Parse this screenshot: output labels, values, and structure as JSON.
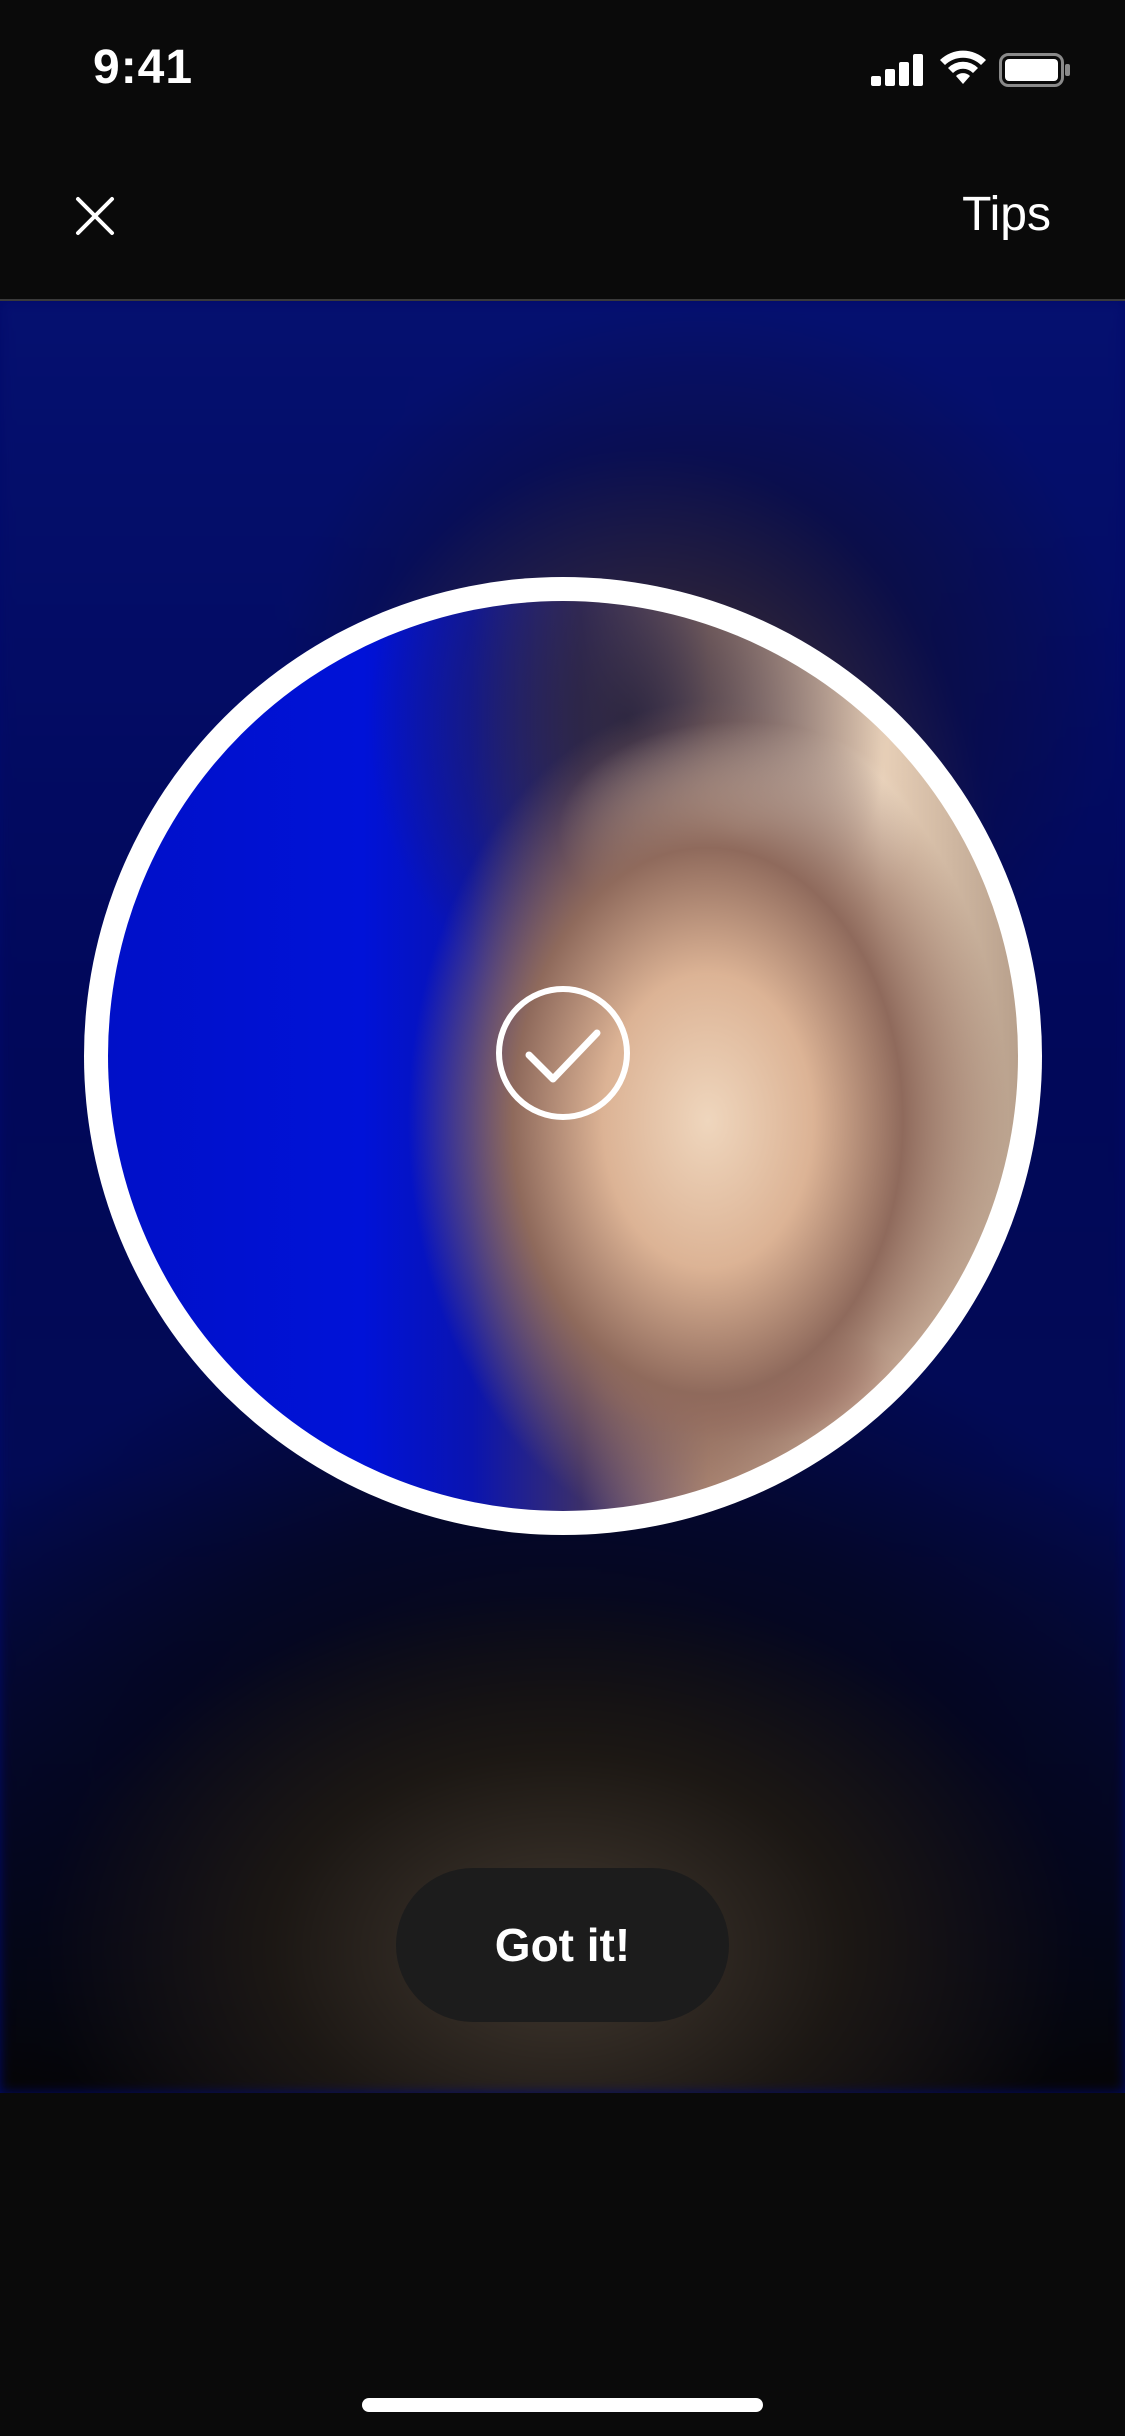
{
  "status_bar": {
    "time": "9:41",
    "icons": [
      "cellular-signal-icon",
      "wifi-icon",
      "battery-icon"
    ]
  },
  "nav": {
    "close_icon": "close-icon",
    "tips_label": "Tips"
  },
  "camera": {
    "overlay_icon": "check-icon",
    "ring_color": "#ffffff"
  },
  "actions": {
    "got_it_label": "Got it!"
  },
  "colors": {
    "background": "#0a0a0a",
    "button_background": "#1c1c1c",
    "text": "#ffffff"
  }
}
